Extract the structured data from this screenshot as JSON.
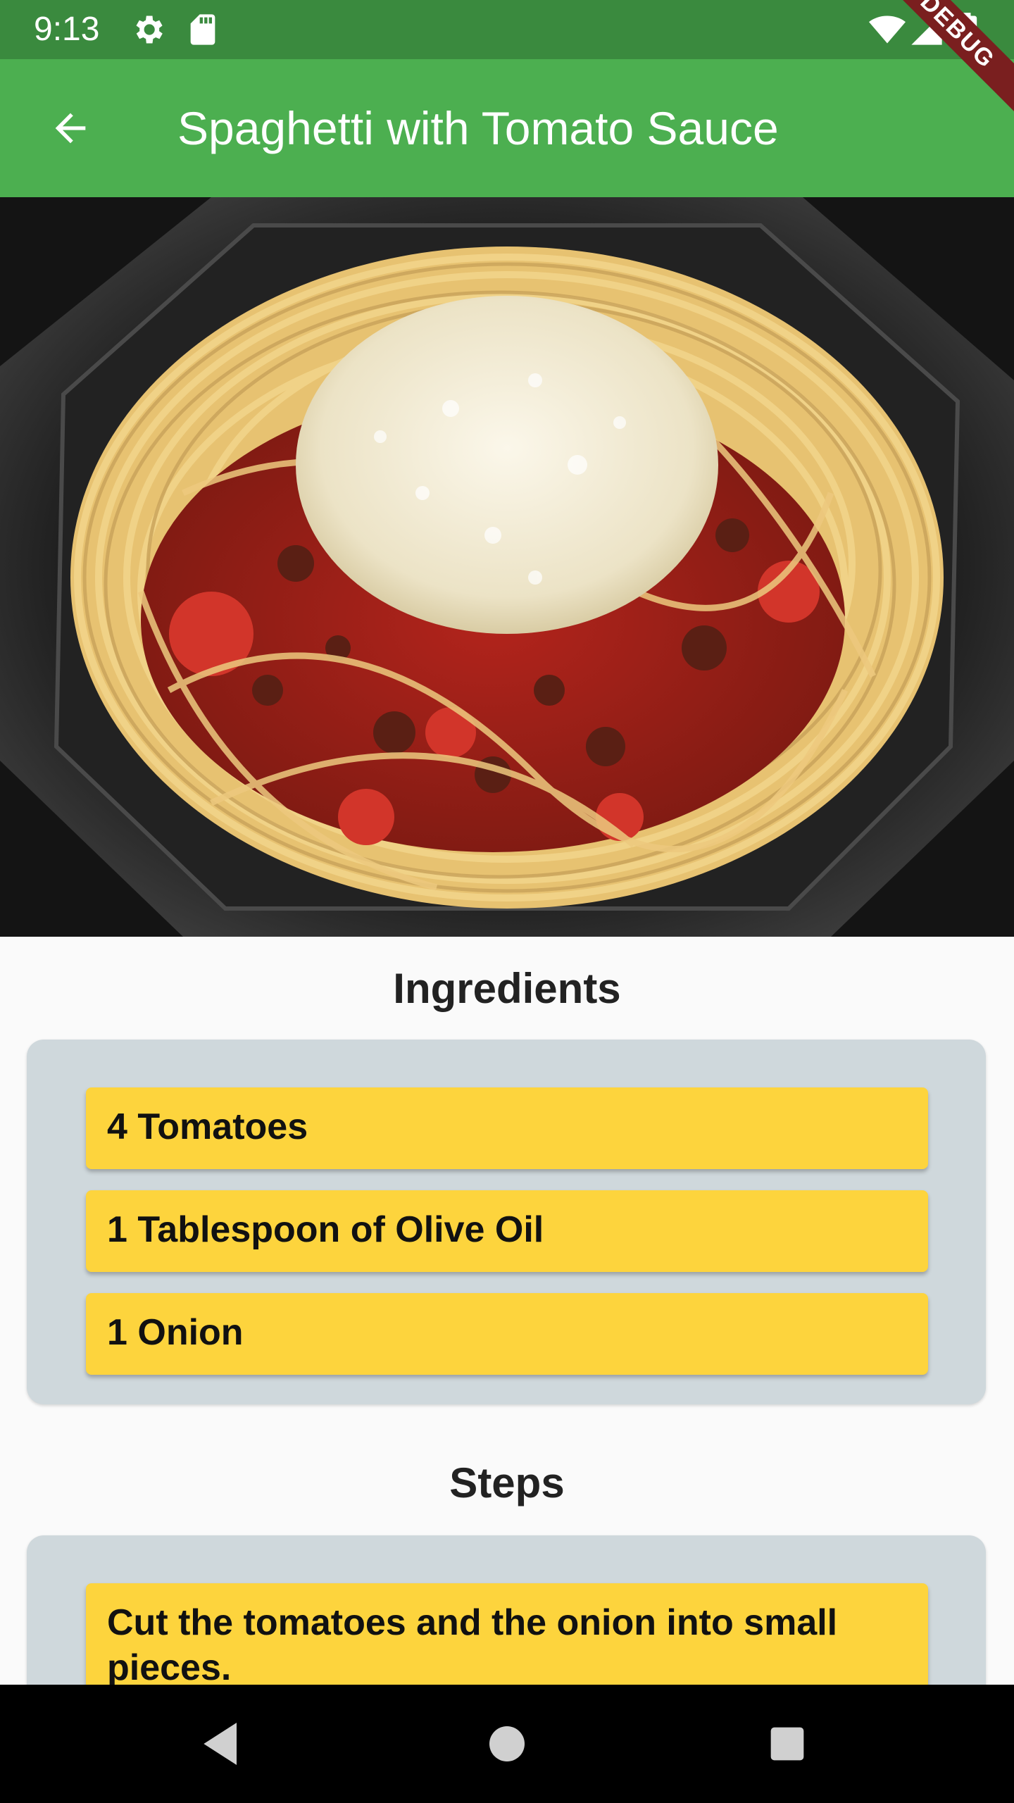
{
  "status_bar": {
    "time": "9:13",
    "icons": [
      "gear-icon",
      "sd-card-icon",
      "wifi-icon",
      "signal-icon",
      "battery-icon"
    ]
  },
  "app_bar": {
    "title": "Spaghetti with Tomato Sauce",
    "back_icon": "arrow-back-icon",
    "color": "#4caf50",
    "status_color": "#3a8a3e"
  },
  "debug_banner": "DEBUG",
  "hero_image": {
    "subject": "spaghetti-with-tomato-sauce-photo"
  },
  "ingredients": {
    "title": "Ingredients",
    "items": [
      "4 Tomatoes",
      "1 Tablespoon of Olive Oil",
      "1 Onion"
    ]
  },
  "steps": {
    "title": "Steps",
    "items": [
      "Cut the tomatoes and the onion into small pieces."
    ]
  },
  "navigation_bar": {
    "buttons": [
      "back-triangle-icon",
      "home-circle-icon",
      "recents-square-icon"
    ]
  },
  "colors": {
    "card": "#fdd43d",
    "panel": "#cfd8dc",
    "background": "#fafafa"
  }
}
